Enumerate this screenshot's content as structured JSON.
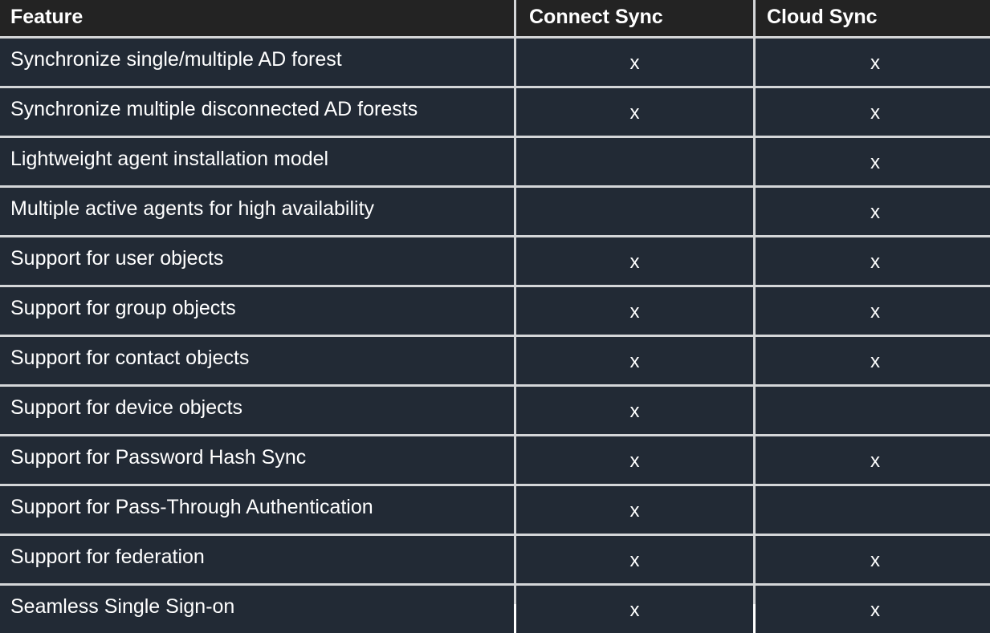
{
  "table": {
    "headers": [
      "Feature",
      "Connect Sync",
      "Cloud Sync"
    ],
    "rows": [
      {
        "feature": "Synchronize single/multiple AD forest",
        "connect": "x",
        "cloud": "x"
      },
      {
        "feature": "Synchronize multiple disconnected AD forests",
        "connect": "x",
        "cloud": "x"
      },
      {
        "feature": "Lightweight agent installation model",
        "connect": "",
        "cloud": "x"
      },
      {
        "feature": "Multiple active agents for high availability",
        "connect": "",
        "cloud": "x"
      },
      {
        "feature": "Support for user objects",
        "connect": "x",
        "cloud": "x"
      },
      {
        "feature": "Support for group objects",
        "connect": "x",
        "cloud": "x"
      },
      {
        "feature": "Support for contact objects",
        "connect": "x",
        "cloud": "x"
      },
      {
        "feature": "Support for device objects",
        "connect": "x",
        "cloud": ""
      },
      {
        "feature": "Support for Password Hash Sync",
        "connect": "x",
        "cloud": "x"
      },
      {
        "feature": "Support for Pass-Through Authentication",
        "connect": "x",
        "cloud": ""
      },
      {
        "feature": "Support for federation",
        "connect": "x",
        "cloud": "x"
      },
      {
        "feature": "Seamless Single Sign-on",
        "connect": "x",
        "cloud": "x"
      }
    ]
  },
  "colors": {
    "header_bg": "#232323",
    "cell_bg": "#222a35",
    "border": "#d4d6d8",
    "text": "#ffffff"
  }
}
